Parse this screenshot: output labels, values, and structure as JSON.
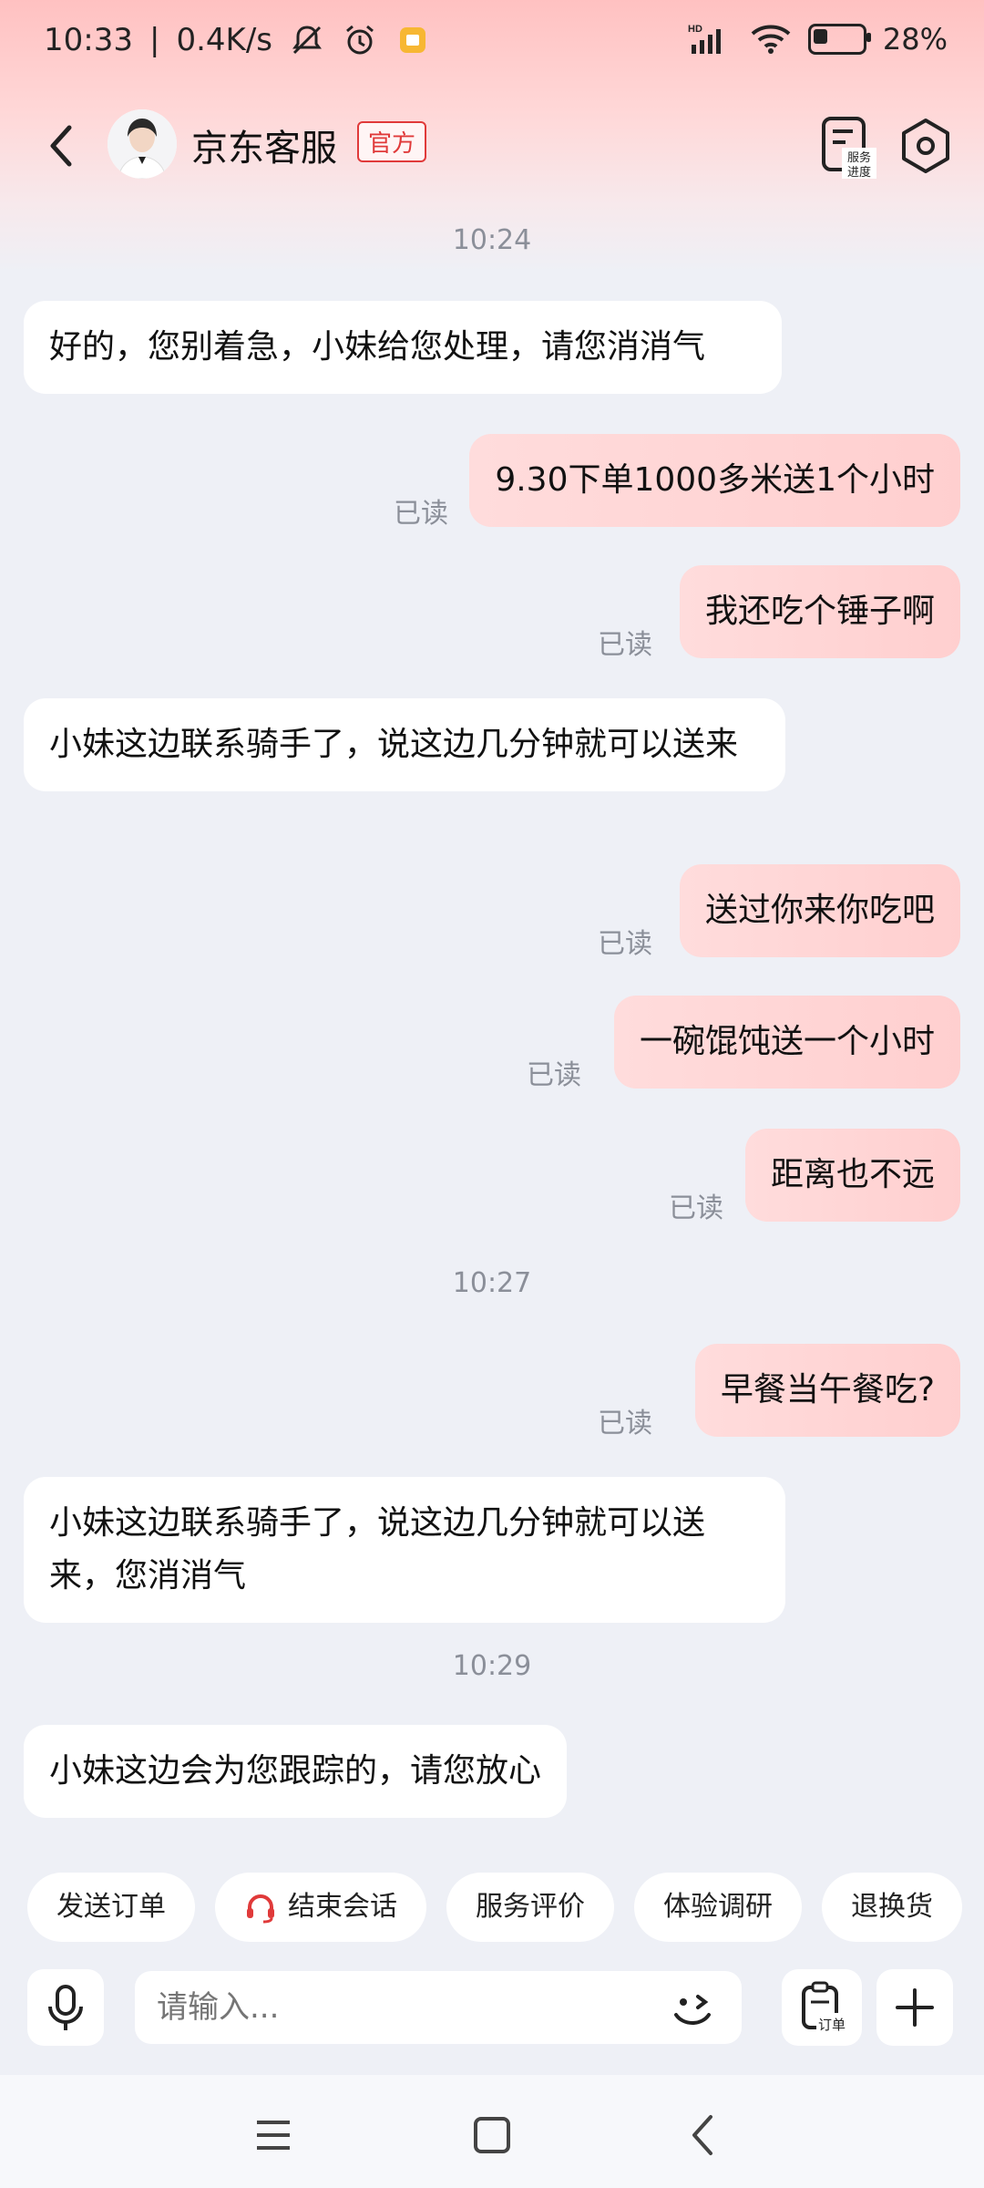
{
  "status": {
    "time": "10:33",
    "net_speed": "0.4K/s",
    "hd": "HD",
    "battery_pct": "28%",
    "battery_level": 0.28
  },
  "header": {
    "title": "京东客服",
    "badge": "官方",
    "progress_label_line1": "服务",
    "progress_label_line2": "进度"
  },
  "messages": [
    {
      "type": "time",
      "text": "10:24"
    },
    {
      "type": "in",
      "text": "好的，您别着急，小妹给您处理，请您消消气"
    },
    {
      "type": "out",
      "text": "9.30下单1000多米送1个小时",
      "read": "已读"
    },
    {
      "type": "out",
      "text": "我还吃个锤子啊",
      "read": "已读"
    },
    {
      "type": "in",
      "text": "小妹这边联系骑手了，说这边几分钟就可以送来"
    },
    {
      "type": "out",
      "text": "送过你来你吃吧",
      "read": "已读"
    },
    {
      "type": "out",
      "text": "一碗馄饨送一个小时",
      "read": "已读"
    },
    {
      "type": "out",
      "text": "距离也不远",
      "read": "已读"
    },
    {
      "type": "time",
      "text": "10:27"
    },
    {
      "type": "out",
      "text": "早餐当午餐吃?",
      "read": "已读"
    },
    {
      "type": "in",
      "text": "小妹这边联系骑手了，说这边几分钟就可以送来，您消消气"
    },
    {
      "type": "time",
      "text": "10:29"
    },
    {
      "type": "in",
      "text": "小妹这边会为您跟踪的，请您放心"
    }
  ],
  "quick_actions": [
    "发送订单",
    "结束会话",
    "服务评价",
    "体验调研",
    "退换货"
  ],
  "input": {
    "placeholder": "请输入...",
    "order_label": "订单"
  },
  "colors": {
    "accent": "#e03a3a",
    "bubble_out": "#ffd6d6",
    "bubble_in": "#ffffff",
    "background": "#eef0f6"
  }
}
